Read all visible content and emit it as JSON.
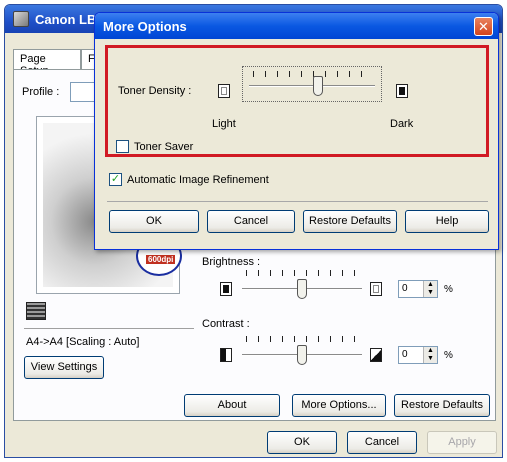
{
  "back_window": {
    "title": "Canon LBP",
    "tabs": [
      "Page Setup",
      "F"
    ],
    "profile_label": "Profile :",
    "dpi_badge": "600dpi",
    "paper_info": "A4->A4 [Scaling : Auto]",
    "view_settings_button": "View Settings",
    "brightness_label": "Brightness :",
    "brightness_value": "0",
    "contrast_label": "Contrast :",
    "contrast_value": "0",
    "percent_unit": "%",
    "buttons": {
      "about": "About",
      "more_options": "More Options...",
      "restore_defaults": "Restore Defaults",
      "ok": "OK",
      "cancel": "Cancel",
      "apply": "Apply"
    }
  },
  "dialog": {
    "title": "More Options",
    "close_glyph": "✕",
    "toner_density_label": "Toner Density :",
    "light_label": "Light",
    "dark_label": "Dark",
    "toner_density_level": 0.55,
    "toner_saver_label": "Toner Saver",
    "toner_saver_checked": false,
    "auto_refinement_label": "Automatic Image Refinement",
    "auto_refinement_checked": true,
    "buttons": {
      "ok": "OK",
      "cancel": "Cancel",
      "restore_defaults": "Restore Defaults",
      "help": "Help"
    }
  },
  "colors": {
    "highlight": "#d11a24",
    "title_bar": "#0a58e2",
    "close_button": "#d3441c"
  },
  "icons": {
    "light": "light-density-icon",
    "dark": "dark-density-icon",
    "close": "close-icon",
    "printer": "printer-icon"
  }
}
